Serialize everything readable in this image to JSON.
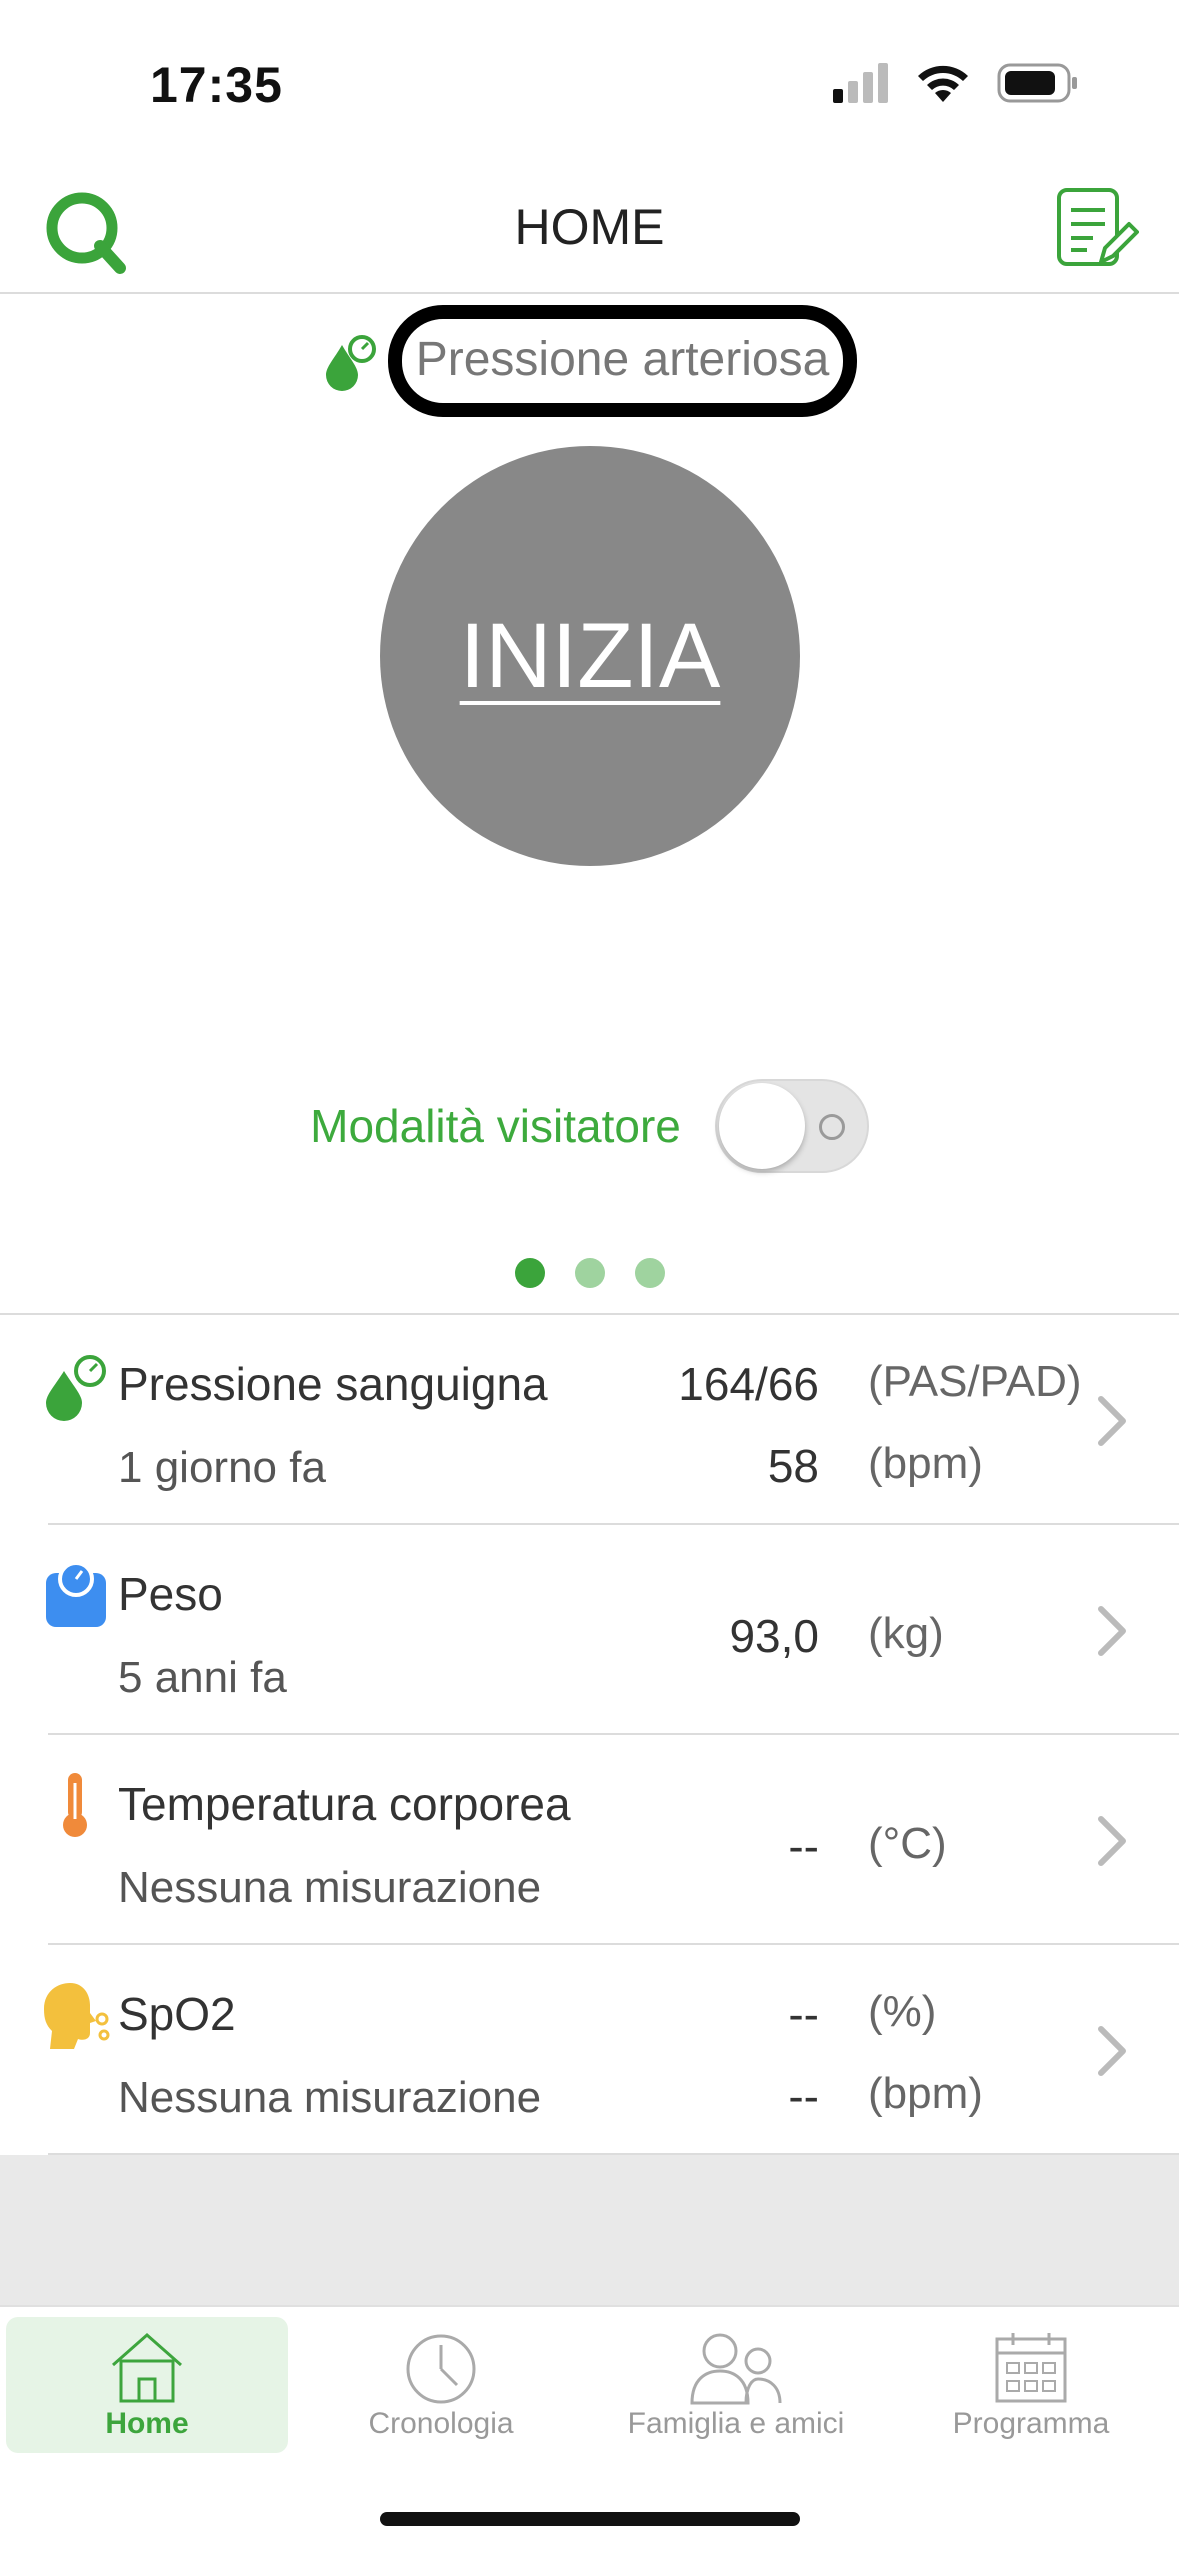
{
  "status_bar": {
    "time": "17:35"
  },
  "header": {
    "title": "HOME"
  },
  "measure": {
    "type_label": "Pressione arteriosa",
    "start_label": "INIZIA"
  },
  "visitor": {
    "label": "Modalità visitatore"
  },
  "pager": {
    "count": 3,
    "active_index": 0
  },
  "measurements": [
    {
      "icon": "blood-pressure-icon",
      "title": "Pressione sanguigna",
      "subtitle": "1 giorno fa",
      "value1": "164/66",
      "unit1": "(PAS/PAD)",
      "value2": "58",
      "unit2": "(bpm)"
    },
    {
      "icon": "scale-icon",
      "title": "Peso",
      "subtitle": "5 anni fa",
      "value1": "93,0",
      "unit1": "(kg)"
    },
    {
      "icon": "thermometer-icon",
      "title": "Temperatura corporea",
      "subtitle": "Nessuna misurazione",
      "value1": "--",
      "unit1": "(°C)"
    },
    {
      "icon": "spo2-icon",
      "title": "SpO2",
      "subtitle": "Nessuna misurazione",
      "value1": "--",
      "unit1": "(%)",
      "value2": "--",
      "unit2": "(bpm)"
    }
  ],
  "tabs": [
    {
      "label": "Home",
      "icon": "home-icon",
      "active": true
    },
    {
      "label": "Cronologia",
      "icon": "clock-icon",
      "active": false
    },
    {
      "label": "Famiglia e amici",
      "icon": "people-icon",
      "active": false
    },
    {
      "label": "Programma",
      "icon": "calendar-icon",
      "active": false
    }
  ],
  "colors": {
    "accent": "#3daa3d",
    "start_button": "#888888",
    "scale_blue": "#3d8ef0",
    "thermo_orange": "#f08a3a",
    "spo2_yellow": "#f3c03d"
  }
}
